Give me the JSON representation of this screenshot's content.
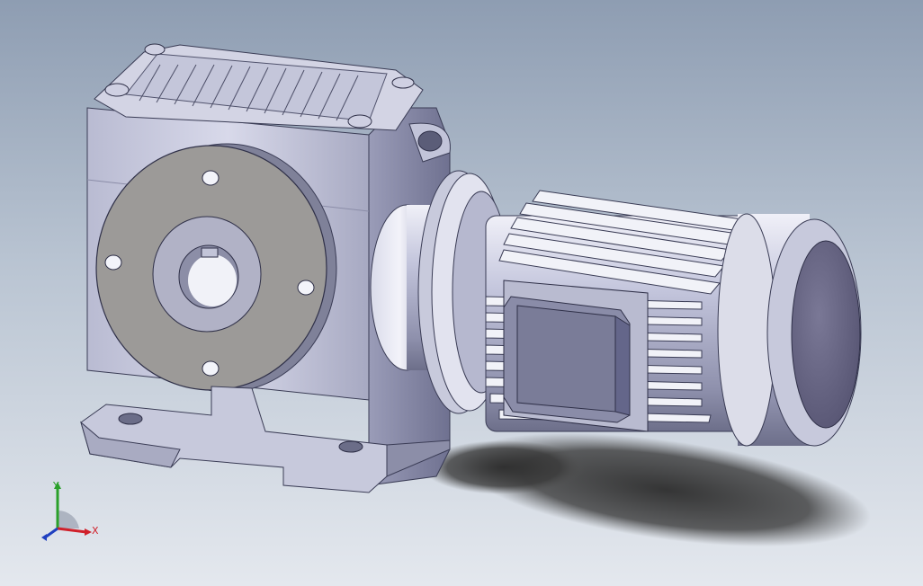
{
  "viewport": {
    "background_top": "#8e9db2",
    "background_bottom": "#e4e8ee"
  },
  "model": {
    "name": "gear-motor-assembly",
    "parts": [
      "gearbox-housing",
      "output-flange",
      "hollow-shaft-bore",
      "mounting-feet",
      "motor-adapter",
      "motor-body",
      "cooling-fins",
      "terminal-box",
      "fan-cover",
      "shadow"
    ],
    "colors": {
      "body": "#c9cbe0",
      "body_dark": "#8c8fa8",
      "flange_face": "#9c9a98",
      "fan_cover": "#6a6884",
      "shadow": "#3a3a3a"
    }
  },
  "triad": {
    "x_label": "X",
    "y_label": "Y",
    "x_color": "#d0202a",
    "y_color": "#2aa02a",
    "z_color": "#2040c0"
  }
}
